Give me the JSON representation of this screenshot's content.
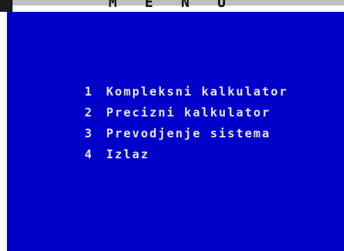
{
  "header": {
    "title": "M E N U"
  },
  "menu": {
    "items": [
      {
        "number": "1",
        "label": "Kompleksni kalkulator"
      },
      {
        "number": "2",
        "label": "Precizni kalkulator"
      },
      {
        "number": "3",
        "label": "Prevodjenje sistema"
      },
      {
        "number": "4",
        "label": "Izlaz"
      }
    ]
  },
  "colors": {
    "background": "#0000c8",
    "text": "#e8e8e8",
    "title_text": "#111111"
  }
}
